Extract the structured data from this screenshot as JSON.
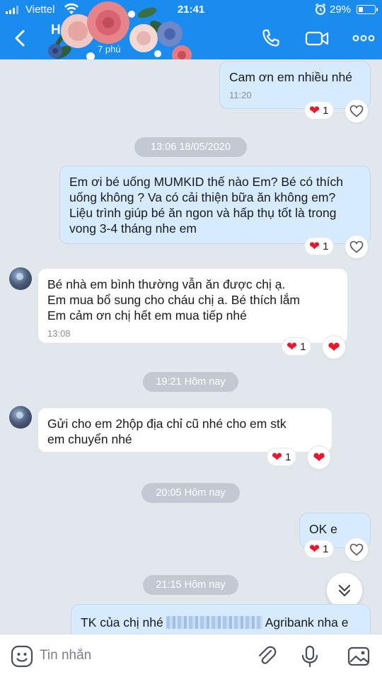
{
  "status_bar": {
    "carrier": "Viettel",
    "time": "21:41",
    "battery": "29%",
    "battery_level": 0.29
  },
  "header": {
    "contact_name": "H",
    "subtitle": "7 phú",
    "icons": [
      "back-arrow-icon",
      "phone-icon",
      "video-camera-icon",
      "more-options-icon"
    ],
    "accent_color": "#1a8cf0"
  },
  "messages": [
    {
      "direction": "out",
      "lines": [
        "Cam ơn em nhiều nhé"
      ],
      "time": "11:20",
      "reaction_count": "1"
    },
    {
      "divider": "13:06 18/05/2020"
    },
    {
      "direction": "out",
      "lines": [
        "Em ơi bé uống MUMKID thế nào Em? Bé có thích",
        "uống không ? Va có cải thiện bữa ăn không em?",
        "Liệu trình giúp bé ăn ngon và hấp thụ tốt là trong",
        "vong 3-4 tháng nhe em"
      ],
      "reaction_count": "1"
    },
    {
      "direction": "in",
      "lines": [
        "Bé  nhà  em  bình  thường  vẫn  ăn  được  chị  ạ.",
        "Em mua  bổ  sung  cho  cháu  chị  a.  Bé  thích  lắm",
        "Em cảm ơn  chị  hết  em mua  tiếp  nhé"
      ],
      "time": "13:08",
      "reaction_count": "1"
    },
    {
      "divider": "19:21 Hôm nay"
    },
    {
      "direction": "in",
      "lines": [
        "Gửi  cho  em  2hộp  địa  chỉ  cũ  nhé  cho em stk",
        "em chuyển  nhé"
      ],
      "reaction_count": "1"
    },
    {
      "divider": "20:05 Hôm nay"
    },
    {
      "direction": "out",
      "lines": [
        "OK e"
      ],
      "reaction_count": "1"
    },
    {
      "divider": "21:15 Hôm nay"
    },
    {
      "direction": "out",
      "text_before": "TK của chị nhé",
      "text_after": "Agribank nha e"
    }
  ],
  "input_bar": {
    "placeholder": "Tin nhắn",
    "icons": [
      "sticker-icon",
      "attachment-icon",
      "microphone-icon",
      "image-icon"
    ]
  },
  "colors": {
    "outgoing_bubble": "#d6ebfd",
    "incoming_bubble": "#ffffff",
    "heart": "#e8192c",
    "chat_background": "#e2e7ee"
  }
}
